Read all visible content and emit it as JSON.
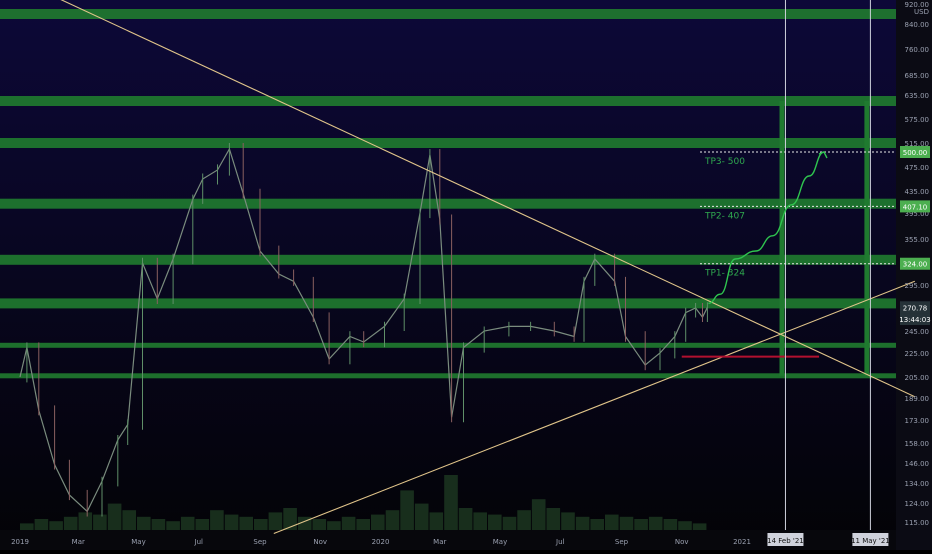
{
  "chart_data": {
    "type": "candlestick",
    "currency": "USD",
    "price_ticks": [
      "920.00",
      "840.00",
      "760.00",
      "685.00",
      "635.00",
      "575.00",
      "515.00",
      "475.00",
      "435.00",
      "395.00",
      "355.00",
      "325.00",
      "295.00",
      "270.78",
      "245.00",
      "225.00",
      "205.00",
      "189.00",
      "173.00",
      "158.00",
      "146.00",
      "134.00",
      "124.00",
      "115.00"
    ],
    "y_axis_badges": [
      {
        "label": "500.00",
        "price": 500,
        "color": "#4caf50"
      },
      {
        "label": "407.10",
        "price": 407,
        "color": "#4caf50"
      },
      {
        "label": "324.00",
        "price": 324,
        "color": "#4caf50"
      },
      {
        "label": "270.78",
        "price": 270.78,
        "color": "#263238"
      },
      {
        "label": "13:44:03",
        "price": 258,
        "color": "#263238"
      }
    ],
    "x_ticks": [
      "2019",
      "Mar",
      "May",
      "Jul",
      "Sep",
      "Nov",
      "2020",
      "Mar",
      "May",
      "Jul",
      "Sep",
      "Nov",
      "2021"
    ],
    "x_badges": [
      "14 Feb '21",
      "11 May '21"
    ],
    "green_zones": [
      {
        "level": 880,
        "thick": true
      },
      {
        "level": 620,
        "thick": true
      },
      {
        "level": 515,
        "thick": true
      },
      {
        "level": 412,
        "thick": true
      },
      {
        "level": 329,
        "thick": true
      },
      {
        "level": 275,
        "thick": true
      },
      {
        "level": 232,
        "thick": false
      },
      {
        "level": 206,
        "thick": false
      }
    ],
    "targets": [
      {
        "label": "TP1- 324",
        "price": 324
      },
      {
        "label": "TP2- 407",
        "price": 407
      },
      {
        "label": "TP3- 500",
        "price": 500
      }
    ],
    "red_support": 222,
    "price_series": [
      {
        "x": "2019-01-01",
        "y": 205
      },
      {
        "x": "2019-01-08",
        "y": 230
      },
      {
        "x": "2019-01-20",
        "y": 180
      },
      {
        "x": "2019-02-05",
        "y": 145
      },
      {
        "x": "2019-02-20",
        "y": 128
      },
      {
        "x": "2019-03-10",
        "y": 120
      },
      {
        "x": "2019-03-25",
        "y": 135
      },
      {
        "x": "2019-04-10",
        "y": 160
      },
      {
        "x": "2019-04-20",
        "y": 170
      },
      {
        "x": "2019-05-05",
        "y": 325
      },
      {
        "x": "2019-05-20",
        "y": 280
      },
      {
        "x": "2019-06-05",
        "y": 330
      },
      {
        "x": "2019-06-25",
        "y": 420
      },
      {
        "x": "2019-07-05",
        "y": 455
      },
      {
        "x": "2019-07-20",
        "y": 470
      },
      {
        "x": "2019-08-01",
        "y": 505
      },
      {
        "x": "2019-08-15",
        "y": 430
      },
      {
        "x": "2019-09-01",
        "y": 340
      },
      {
        "x": "2019-09-20",
        "y": 310
      },
      {
        "x": "2019-10-05",
        "y": 300
      },
      {
        "x": "2019-10-25",
        "y": 260
      },
      {
        "x": "2019-11-10",
        "y": 220
      },
      {
        "x": "2019-12-01",
        "y": 240
      },
      {
        "x": "2019-12-15",
        "y": 235
      },
      {
        "x": "2020-01-05",
        "y": 250
      },
      {
        "x": "2020-01-25",
        "y": 280
      },
      {
        "x": "2020-02-10",
        "y": 395
      },
      {
        "x": "2020-02-20",
        "y": 495
      },
      {
        "x": "2020-03-01",
        "y": 385
      },
      {
        "x": "2020-03-13",
        "y": 175
      },
      {
        "x": "2020-03-25",
        "y": 230
      },
      {
        "x": "2020-04-15",
        "y": 245
      },
      {
        "x": "2020-05-10",
        "y": 250
      },
      {
        "x": "2020-06-01",
        "y": 250
      },
      {
        "x": "2020-06-25",
        "y": 245
      },
      {
        "x": "2020-07-15",
        "y": 240
      },
      {
        "x": "2020-07-25",
        "y": 300
      },
      {
        "x": "2020-08-05",
        "y": 330
      },
      {
        "x": "2020-08-25",
        "y": 300
      },
      {
        "x": "2020-09-05",
        "y": 240
      },
      {
        "x": "2020-09-25",
        "y": 215
      },
      {
        "x": "2020-10-10",
        "y": 225
      },
      {
        "x": "2020-10-25",
        "y": 240
      },
      {
        "x": "2020-11-05",
        "y": 265
      },
      {
        "x": "2020-11-15",
        "y": 270
      },
      {
        "x": "2020-11-22",
        "y": 260
      },
      {
        "x": "2020-11-27",
        "y": 270.78
      }
    ],
    "projection": [
      {
        "x": "2020-11-28",
        "y": 275
      },
      {
        "x": "2020-12-10",
        "y": 285
      },
      {
        "x": "2020-12-25",
        "y": 330
      },
      {
        "x": "2021-01-15",
        "y": 340
      },
      {
        "x": "2021-02-01",
        "y": 360
      },
      {
        "x": "2021-02-20",
        "y": 410
      },
      {
        "x": "2021-03-10",
        "y": 460
      },
      {
        "x": "2021-03-25",
        "y": 500
      }
    ],
    "volume_series": [
      3,
      5,
      4,
      6,
      8,
      7,
      12,
      9,
      6,
      5,
      4,
      6,
      5,
      9,
      7,
      6,
      5,
      8,
      10,
      6,
      5,
      4,
      6,
      5,
      7,
      9,
      18,
      12,
      8,
      25,
      10,
      8,
      7,
      6,
      9,
      14,
      10,
      8,
      6,
      5,
      7,
      6,
      5,
      6,
      5,
      4,
      3
    ],
    "trendlines": [
      {
        "from": {
          "x": "2018-11-15",
          "y": 1100
        },
        "to": {
          "x": "2021-06-25",
          "y": 190
        }
      },
      {
        "from": {
          "x": "2019-09-15",
          "y": 110
        },
        "to": {
          "x": "2021-06-25",
          "y": 300
        }
      }
    ],
    "vertical_markers": [
      "2021-02-14",
      "2021-05-11"
    ]
  }
}
